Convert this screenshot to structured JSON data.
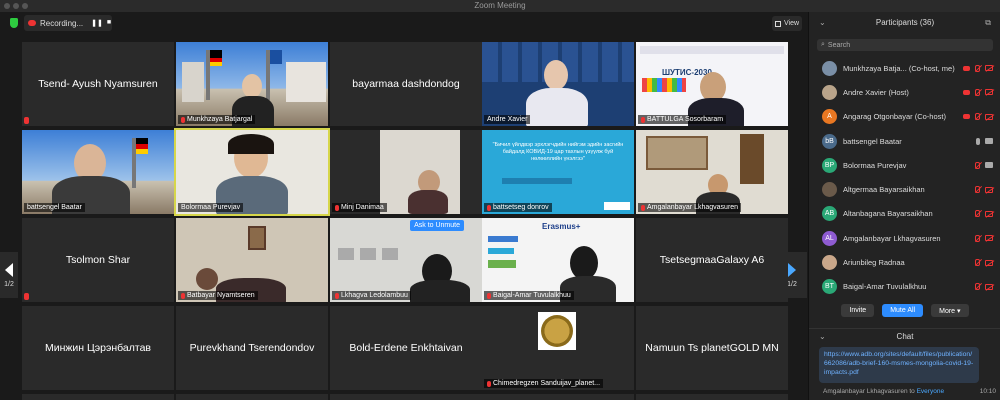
{
  "window": {
    "title": "Zoom Meeting"
  },
  "topbar": {
    "recording_label": "Recording...",
    "pause_glyph": "❚❚",
    "stop_glyph": "■",
    "view_label": "View"
  },
  "paging": {
    "left": "1/2",
    "right": "1/2"
  },
  "tiles": [
    {
      "big": "Tsend- Ayush Nyamsuren"
    },
    {
      "label": "Munkhzaya Batjargal"
    },
    {
      "big": "bayarmaa dashdondog"
    },
    {
      "label": "Andre Xavier"
    },
    {
      "label": "BATTULGA Sosorbaram",
      "slide_title": "ШУТИС-2030"
    },
    {
      "label": "battsengel Baatar"
    },
    {
      "label": "Bolormaa Purevjav"
    },
    {
      "label": "Minj Danimaa"
    },
    {
      "label": "battsetseg donrov",
      "slide_text": "\"Бичил үйлдвэр эрхлэгчдийн нийгэм эдийн засгийн байдалд КОВИД-19 цар тахлын үзүүлж буй нөлөөллийн үнэлгээ\""
    },
    {
      "label": "Amgalanbayar Lkhagvasuren"
    },
    {
      "big": "Tsolmon Shar"
    },
    {
      "label": "Batbayar Nyamtseren"
    },
    {
      "label": "Lkhagva Ledolambuu",
      "button": "Ask to Unmute"
    },
    {
      "label": "Baigal-Amar Tuvulalkhuu",
      "slide_title": "Erasmus+"
    },
    {
      "big": "TsetsegmaaGalaxy A6"
    },
    {
      "big": "Минжин Цэрэнбалтав"
    },
    {
      "big": "Purevkhand Tserendondov"
    },
    {
      "big": "Bold-Erdene Enkhtaivan"
    },
    {
      "label": "Chimedregzen Sanduijav_planet..."
    },
    {
      "big": "Namuun Ts planetGOLD MN"
    }
  ],
  "participants": {
    "header": "Participants (36)",
    "search_placeholder": "Search",
    "list": [
      {
        "name": "Munkhzaya Batja... (Co-host, me)",
        "avatar": "",
        "color": "#7a8fa6",
        "rec": true,
        "mic": "off",
        "cam": "off"
      },
      {
        "name": "Andre Xavier (Host)",
        "avatar": "",
        "color": "#b9a48a",
        "rec": true,
        "mic": "off",
        "cam": "off"
      },
      {
        "name": "Angarag Otgonbayar (Co-host)",
        "avatar": "A",
        "color": "#e87722",
        "rec": true,
        "mic": "off",
        "cam": "off"
      },
      {
        "name": "battsengel Baatar",
        "avatar": "bB",
        "color": "#4a6a8a",
        "rec": false,
        "mic": "on",
        "cam": "on"
      },
      {
        "name": "Bolormaa Purevjav",
        "avatar": "BP",
        "color": "#2aa876",
        "rec": false,
        "mic": "off",
        "cam": "on"
      },
      {
        "name": "Altgermaa Bayarsaikhan",
        "avatar": "",
        "color": "#6a5a4a",
        "rec": false,
        "mic": "off",
        "cam": "off"
      },
      {
        "name": "Altanbagana Bayarsaikhan",
        "avatar": "AB",
        "color": "#2aa876",
        "rec": false,
        "mic": "off",
        "cam": "off"
      },
      {
        "name": "Amgalanbayar Lkhagvasuren",
        "avatar": "AL",
        "color": "#8e5bd1",
        "rec": false,
        "mic": "off",
        "cam": "off"
      },
      {
        "name": "Ariunbileg Radnaa",
        "avatar": "",
        "color": "#c9a78a",
        "rec": false,
        "mic": "off",
        "cam": "off"
      },
      {
        "name": "Baigal-Amar Tuvulalkhuu",
        "avatar": "BT",
        "color": "#2aa876",
        "rec": false,
        "mic": "off",
        "cam": "off"
      }
    ],
    "buttons": {
      "invite": "Invite",
      "mute_all": "Mute All",
      "more": "More ▾"
    }
  },
  "chat": {
    "header": "Chat",
    "link": "https://www.adb.org/sites/default/files/publication/662086/adb-brief-160-msmes-mongolia-covid-19-impacts.pdf",
    "sender_line": "Amgalanbayar Lkhagvasuren to",
    "recipient": "Everyone",
    "time": "10:10"
  },
  "colors": {
    "accent": "#2d8cff",
    "active_speaker": "#d6d64a",
    "muted": "#e33333"
  }
}
